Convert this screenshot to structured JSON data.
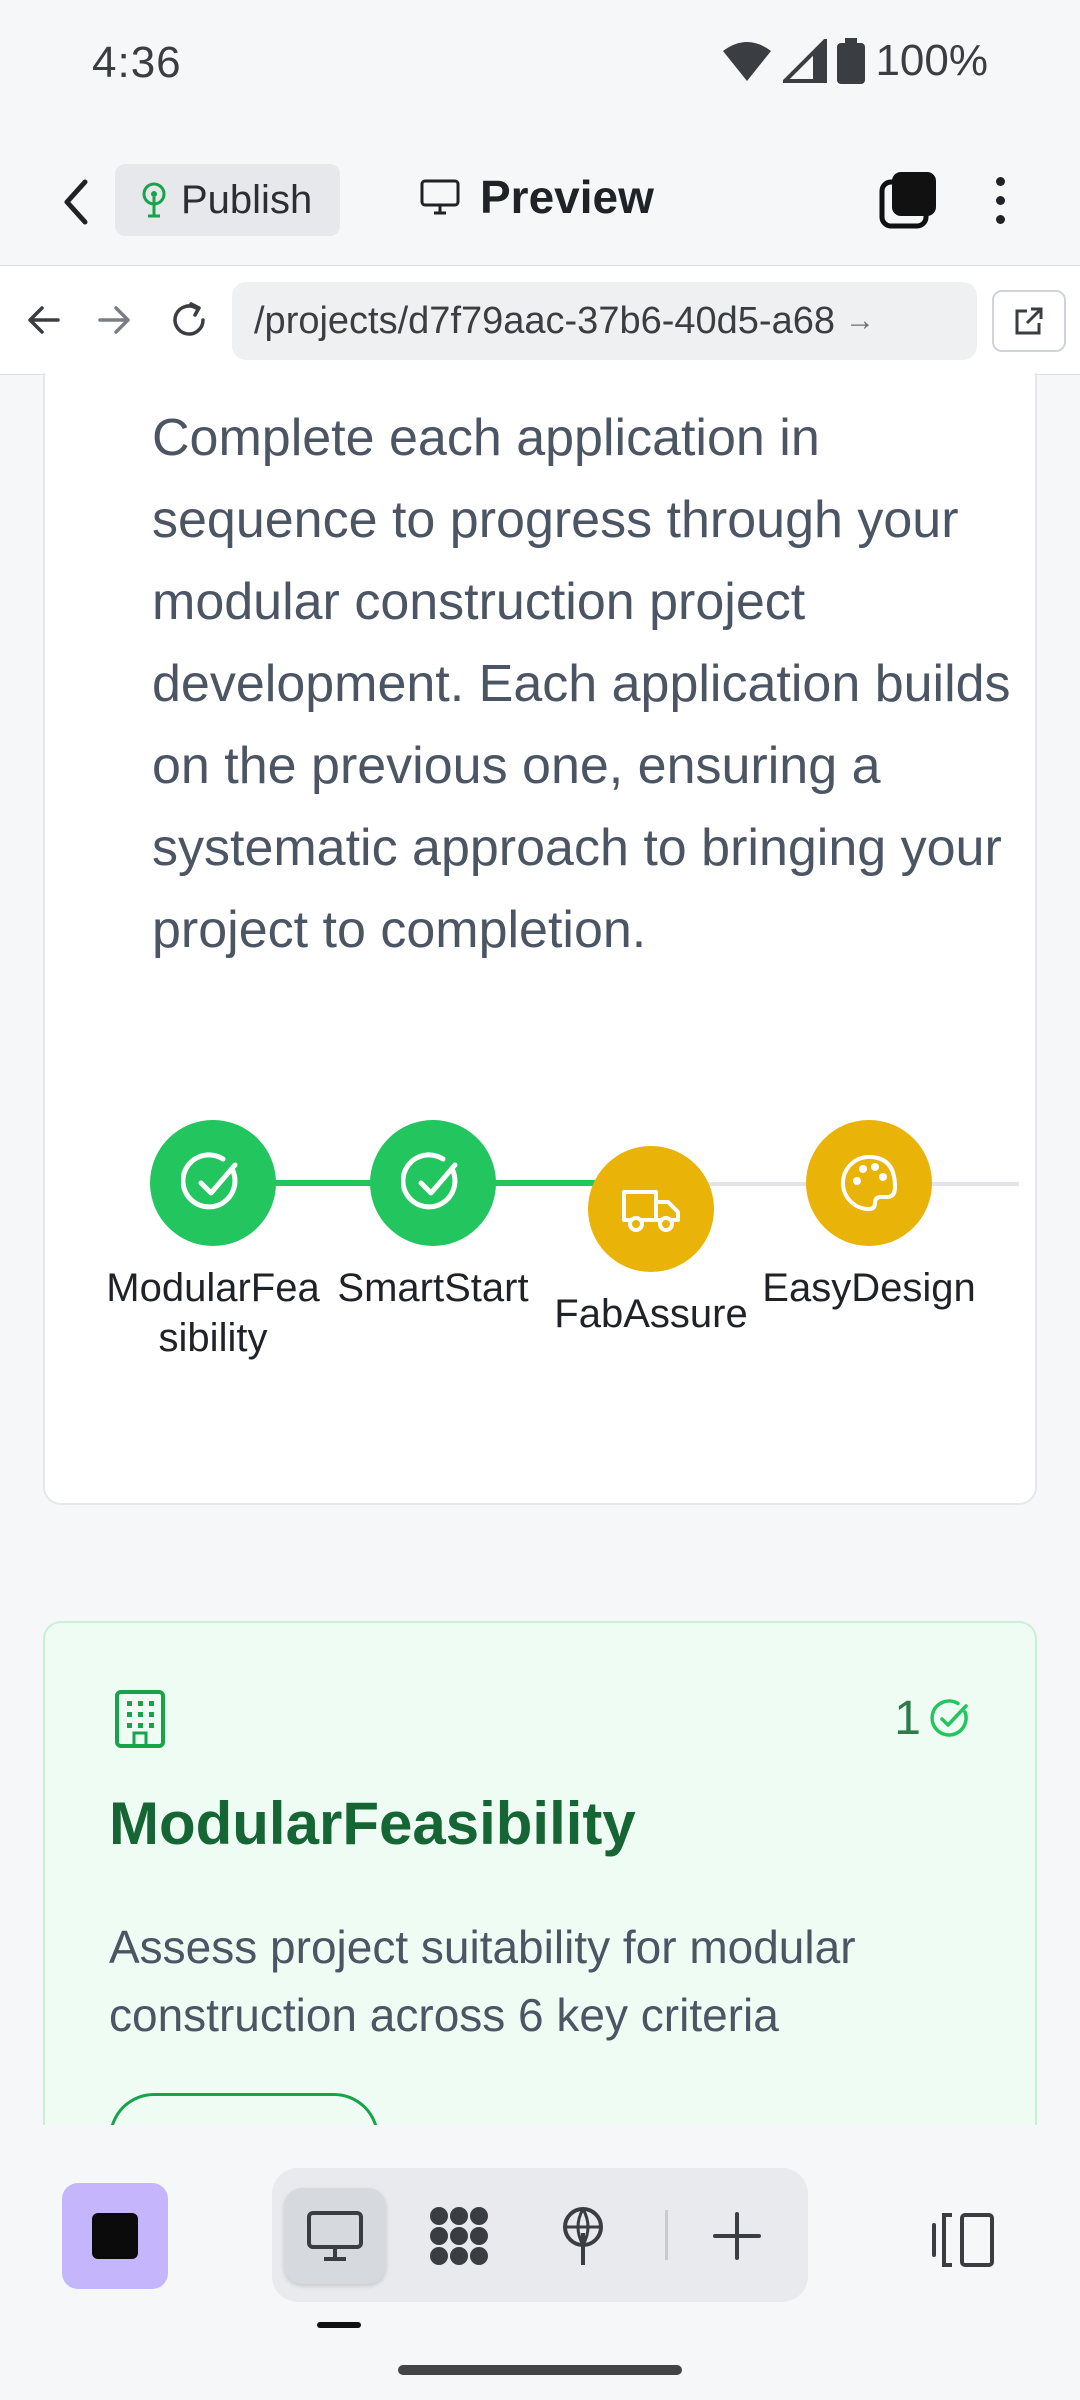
{
  "status_bar": {
    "time": "4:36",
    "battery": "100%"
  },
  "app_header": {
    "publish_label": "Publish",
    "preview_label": "Preview"
  },
  "browser": {
    "url": "/projects/d7f79aac-37b6-40d5-a68"
  },
  "intro": {
    "text": "Complete each application in sequence to progress through your modular construction project development. Each application builds on the previous one, ensuring a systematic approach to bringing your project to completion."
  },
  "steps": [
    {
      "label": "ModularFeasibility",
      "state": "done",
      "icon": "check-circle-icon"
    },
    {
      "label": "SmartStart",
      "state": "done",
      "icon": "check-circle-icon"
    },
    {
      "label": "FabAssure",
      "state": "current",
      "icon": "truck-icon"
    },
    {
      "label": "EasyDesign",
      "state": "upcoming",
      "icon": "palette-icon"
    }
  ],
  "app_card": {
    "step_number": "1",
    "title": "ModularFeasibility",
    "description": "Assess project suitability for modular construction across 6 key criteria",
    "icon": "building-icon"
  },
  "colors": {
    "done": "#22c55e",
    "pending": "#eab308",
    "card_title": "#166534",
    "accent_purple": "#c4b5fd"
  }
}
